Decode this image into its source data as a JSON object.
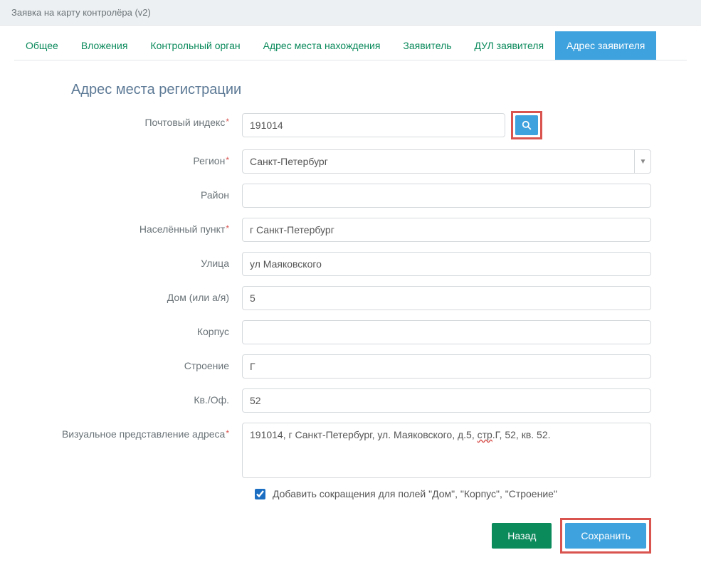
{
  "header": {
    "title": "Заявка на карту контролёра (v2)"
  },
  "tabs": [
    {
      "label": "Общее"
    },
    {
      "label": "Вложения"
    },
    {
      "label": "Контрольный орган"
    },
    {
      "label": "Адрес места нахождения"
    },
    {
      "label": "Заявитель"
    },
    {
      "label": "ДУЛ заявителя"
    },
    {
      "label": "Адрес заявителя",
      "active": true
    }
  ],
  "form": {
    "title": "Адрес места регистрации",
    "postcode": {
      "label": "Почтовый индекс",
      "value": "191014"
    },
    "region": {
      "label": "Регион",
      "value": "Санкт-Петербург"
    },
    "district": {
      "label": "Район",
      "value": ""
    },
    "city": {
      "label": "Населённый пункт",
      "value": "г Санкт-Петербург"
    },
    "street": {
      "label": "Улица",
      "value": "ул Маяковского"
    },
    "house": {
      "label": "Дом (или а/я)",
      "value": "5"
    },
    "korpus": {
      "label": "Корпус",
      "value": ""
    },
    "stroenie": {
      "label": "Строение",
      "value": "Г"
    },
    "kvof": {
      "label": "Кв./Оф.",
      "value": "52"
    },
    "visual": {
      "label": "Визуальное представление адреса",
      "part1": "191014, г Санкт-Петербург, ул. Маяковского, д.5, ",
      "part2_u": "стр",
      "part3": ".Г, 52, кв. 52."
    },
    "checkbox": {
      "label": "Добавить сокращения для полей \"Дом\", \"Корпус\", \"Строение\"",
      "checked": true
    }
  },
  "buttons": {
    "back": "Назад",
    "save": "Сохранить"
  }
}
